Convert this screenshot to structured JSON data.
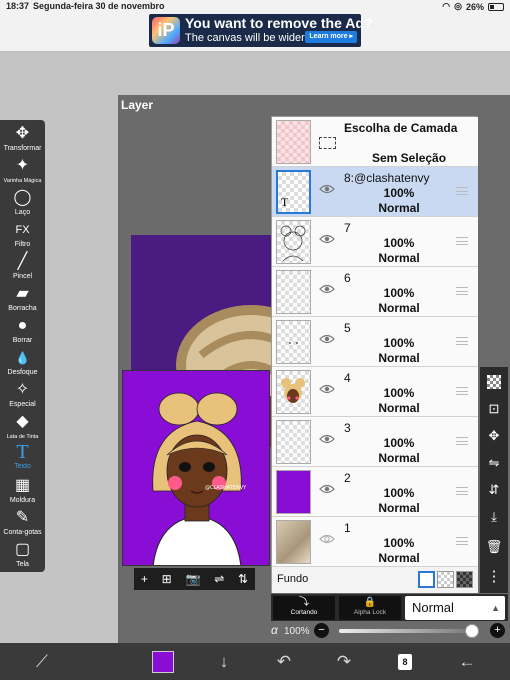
{
  "status": {
    "time": "18:37",
    "date": "Segunda-feira 30 de novembro",
    "battery": "26%"
  },
  "ad": {
    "logo": "iP",
    "title": "You want to remove the Ad?",
    "subtitle": "The canvas will be wider.",
    "button": "Learn more ▸"
  },
  "tools": [
    {
      "label": "Transformar",
      "icon": "✥"
    },
    {
      "label": "Varinha Mágica",
      "icon": "✦"
    },
    {
      "label": "Laço",
      "icon": "◯"
    },
    {
      "label": "Filtro",
      "icon": "FX"
    },
    {
      "label": "Pincel",
      "icon": "╱"
    },
    {
      "label": "Borracha",
      "icon": "▰"
    },
    {
      "label": "Borrar",
      "icon": "●"
    },
    {
      "label": "Desfoque",
      "icon": "💧"
    },
    {
      "label": "Especial",
      "icon": "✧"
    },
    {
      "label": "Lata de Tinta",
      "icon": "◆"
    },
    {
      "label": "Texto",
      "icon": "T"
    },
    {
      "label": "Moldura",
      "icon": "▦"
    },
    {
      "label": "Conta-gotas",
      "icon": "✎"
    },
    {
      "label": "Tela",
      "icon": "▢"
    }
  ],
  "workarea": {
    "title": "Layer"
  },
  "canvas_tools": [
    "+",
    "⊞",
    "📷",
    "⇌",
    "⇅"
  ],
  "layers_panel": {
    "selection": {
      "title": "Escolha de Camada",
      "subtitle": "Sem Seleção"
    },
    "layers": [
      {
        "name": "8:@clashatenvy",
        "opacity": "100%",
        "mode": "Normal",
        "thumb_glyph": "T"
      },
      {
        "name": "7",
        "opacity": "100%",
        "mode": "Normal",
        "thumb_glyph": ""
      },
      {
        "name": "6",
        "opacity": "100%",
        "mode": "Normal",
        "thumb_glyph": ""
      },
      {
        "name": "5",
        "opacity": "100%",
        "mode": "Normal",
        "thumb_glyph": ""
      },
      {
        "name": "4",
        "opacity": "100%",
        "mode": "Normal",
        "thumb_glyph": ""
      },
      {
        "name": "3",
        "opacity": "100%",
        "mode": "Normal",
        "thumb_glyph": ""
      },
      {
        "name": "2",
        "opacity": "100%",
        "mode": "Normal",
        "thumb_glyph": ""
      },
      {
        "name": "1",
        "opacity": "100%",
        "mode": "Normal",
        "thumb_glyph": ""
      }
    ],
    "fundo_label": "Fundo"
  },
  "right_icons": [
    "checker-icon",
    "move-layer-icon",
    "move-icon",
    "flip-horizontal-icon",
    "flip-vertical-icon",
    "merge-down-icon",
    "trash-icon",
    "more-icon"
  ],
  "blend": {
    "clipping_label": "Cortando",
    "alpha_lock_label": "Alpha Lock",
    "mode": "Normal",
    "alpha_symbol": "α",
    "alpha_value": "100%",
    "alpha_level": 1.0
  },
  "bottom": {
    "color": "#8a0dd6",
    "layer_count": "8"
  }
}
